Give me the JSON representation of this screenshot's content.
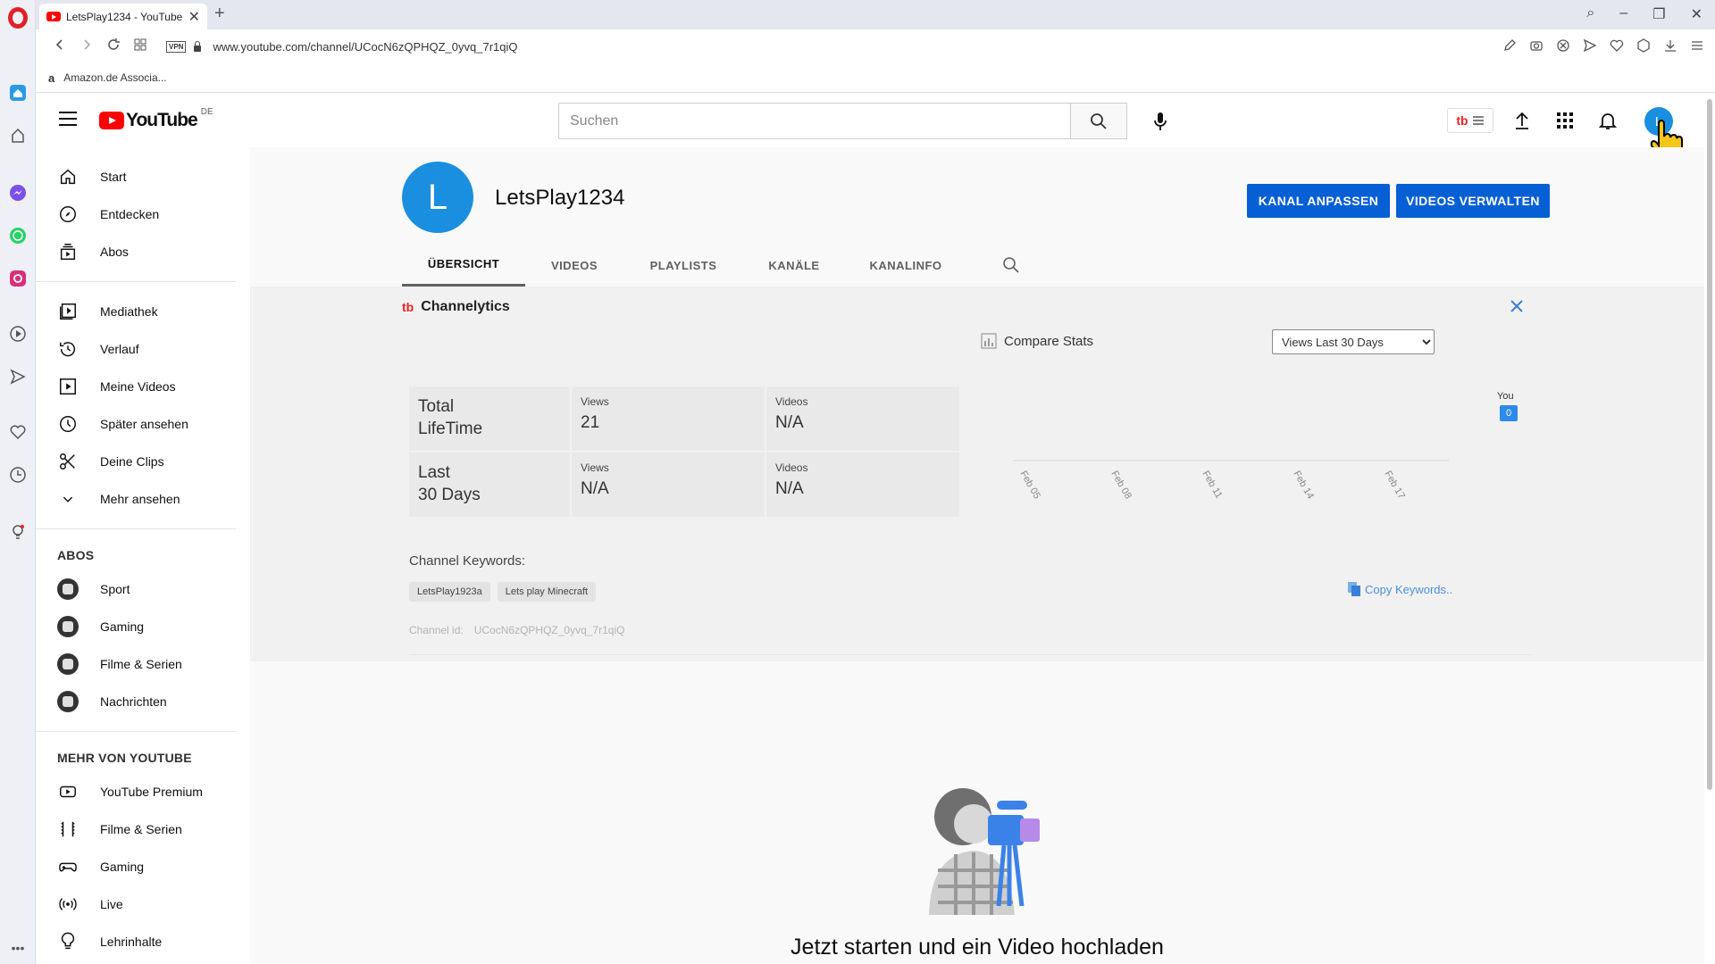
{
  "browser": {
    "tab_title": "LetsPlay1234 - YouTube",
    "tab_close": "✕",
    "new_tab": "+",
    "url": "www.youtube.com/channel/UCocN6zQPHQZ_0yvq_7r1qiQ",
    "vpn_label": "VPN",
    "bookmark": "Amazon.de Associa...",
    "bookmark_icon": "a",
    "win_controls": [
      "⌕",
      "–",
      "❐",
      "✕"
    ]
  },
  "header": {
    "logo_text": "YouTube",
    "country_code": "DE",
    "search_placeholder": "Suchen",
    "avatar_letter": "L"
  },
  "sidebar": {
    "main": [
      {
        "label": "Start",
        "icon": "home-icon"
      },
      {
        "label": "Entdecken",
        "icon": "compass-icon"
      },
      {
        "label": "Abos",
        "icon": "subscriptions-icon"
      }
    ],
    "library": [
      {
        "label": "Mediathek",
        "icon": "library-icon"
      },
      {
        "label": "Verlauf",
        "icon": "history-icon"
      },
      {
        "label": "Meine Videos",
        "icon": "my-videos-icon"
      },
      {
        "label": "Später ansehen",
        "icon": "clock-icon"
      },
      {
        "label": "Deine Clips",
        "icon": "scissors-icon"
      },
      {
        "label": "Mehr ansehen",
        "icon": "chevron-down-icon"
      }
    ],
    "abos_heading": "ABOS",
    "abos": [
      {
        "label": "Sport"
      },
      {
        "label": "Gaming"
      },
      {
        "label": "Filme & Serien"
      },
      {
        "label": "Nachrichten"
      }
    ],
    "more_heading": "MEHR VON YOUTUBE",
    "more": [
      {
        "label": "YouTube Premium",
        "icon": "youtube-play-icon"
      },
      {
        "label": "Filme & Serien",
        "icon": "film-icon"
      },
      {
        "label": "Gaming",
        "icon": "gamepad-icon"
      },
      {
        "label": "Live",
        "icon": "live-icon"
      },
      {
        "label": "Lehrinhalte",
        "icon": "lightbulb-icon"
      }
    ]
  },
  "channel": {
    "avatar_letter": "L",
    "name": "LetsPlay1234",
    "btn_customize": "KANAL ANPASSEN",
    "btn_manage": "VIDEOS VERWALTEN",
    "tabs": [
      "ÜBERSICHT",
      "VIDEOS",
      "PLAYLISTS",
      "KANÄLE",
      "KANALINFO"
    ],
    "active_tab": 0
  },
  "channelytics": {
    "icon_text": "tb",
    "title": "Channelytics",
    "compare": "Compare Stats",
    "period_select": "Views Last 30 Days",
    "rows": [
      {
        "label_line1": "Total",
        "label_line2": "LifeTime",
        "views_label": "Views",
        "views": "21",
        "videos_label": "Videos",
        "videos": "N/A"
      },
      {
        "label_line1": "Last",
        "label_line2": "30 Days",
        "views_label": "Views",
        "views": "N/A",
        "videos_label": "Videos",
        "videos": "N/A"
      }
    ],
    "you_label": "You",
    "you_value": "0",
    "keywords_title": "Channel Keywords:",
    "keywords": [
      "LetsPlay1923a",
      "Lets play Minecraft"
    ],
    "copy_keywords": "Copy Keywords..",
    "channel_id_label": "Channel id:",
    "channel_id": "UCocN6zQPHQZ_0yvq_7r1qiQ"
  },
  "chart_data": {
    "type": "line",
    "categories": [
      "Feb 05",
      "Feb 08",
      "Feb 11",
      "Feb 14",
      "Feb 17"
    ],
    "series": [],
    "title": "",
    "xlabel": "",
    "ylabel": ""
  },
  "empty_state": {
    "title": "Jetzt starten und ein Video hochladen"
  },
  "colors": {
    "accent": "#065fd4",
    "avatar": "#1a8fe0",
    "brand_red": "#ff0000"
  }
}
